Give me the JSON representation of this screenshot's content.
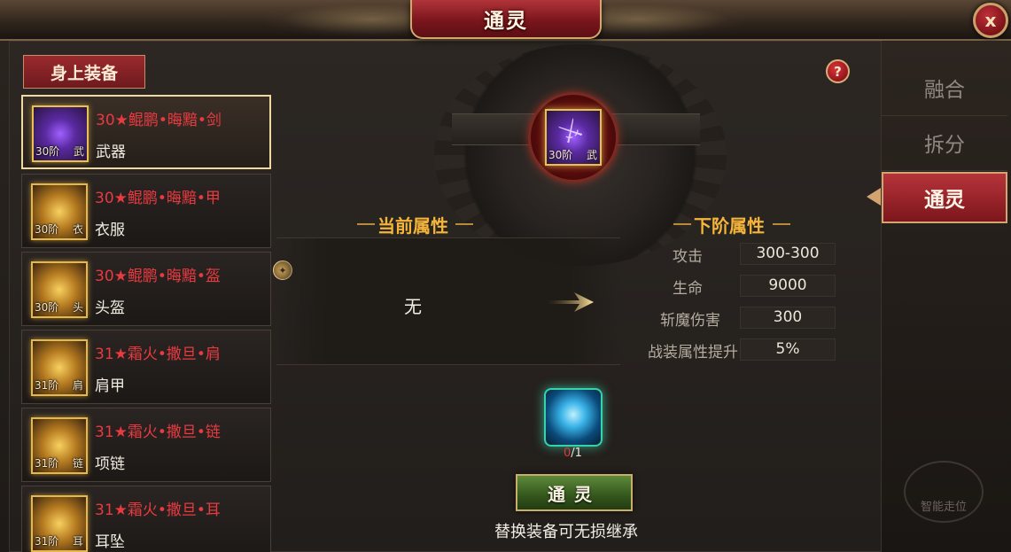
{
  "window": {
    "title": "通灵",
    "close_label": "x"
  },
  "equipment_panel": {
    "header": "身上装备",
    "items": [
      {
        "name": "30★鲲鹏•晦黯•剑",
        "type": "武器",
        "tier": "30阶",
        "slot": "武",
        "selected": true
      },
      {
        "name": "30★鲲鹏•晦黯•甲",
        "type": "衣服",
        "tier": "30阶",
        "slot": "衣",
        "selected": false
      },
      {
        "name": "30★鲲鹏•晦黯•盔",
        "type": "头盔",
        "tier": "30阶",
        "slot": "头",
        "selected": false
      },
      {
        "name": "31★霜火•撒旦•肩",
        "type": "肩甲",
        "tier": "31阶",
        "slot": "肩",
        "selected": false
      },
      {
        "name": "31★霜火•撒旦•链",
        "type": "项链",
        "tier": "31阶",
        "slot": "链",
        "selected": false
      },
      {
        "name": "31★霜火•撒旦•耳",
        "type": "耳坠",
        "tier": "31阶",
        "slot": "耳",
        "selected": false
      }
    ]
  },
  "center_item": {
    "tier": "30阶",
    "slot": "武"
  },
  "help_label": "?",
  "current_attrs": {
    "heading": "当前属性",
    "value": "无"
  },
  "next_attrs": {
    "heading": "下阶属性",
    "rows": [
      {
        "label": "攻击",
        "value": "300-300"
      },
      {
        "label": "生命",
        "value": "9000"
      },
      {
        "label": "斩魔伤害",
        "value": "300"
      },
      {
        "label": "战装属性提升",
        "value": "5%"
      }
    ]
  },
  "material": {
    "have": "0",
    "need": "/1"
  },
  "action_button": "通灵",
  "hint": "替换装备可无损继承",
  "tabs": [
    {
      "label": "融合",
      "active": false
    },
    {
      "label": "拆分",
      "active": false
    },
    {
      "label": "通灵",
      "active": true
    }
  ],
  "background_text": "智能走位",
  "icons": [
    "close-icon",
    "help-icon",
    "arrow-right-icon",
    "pin-icon",
    "sword-icon",
    "orb-icon"
  ],
  "colors": {
    "accent_red": "#8a1a20",
    "gold": "#f5b43a",
    "item_name_red": "#e83a40",
    "button_green": "#3f6a24"
  }
}
